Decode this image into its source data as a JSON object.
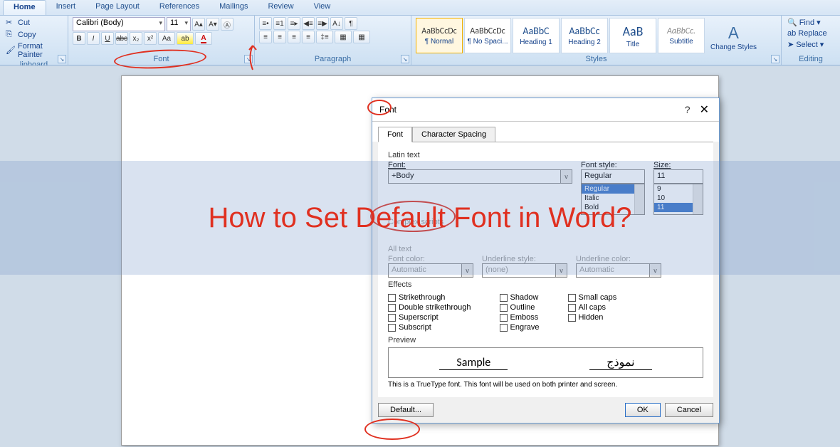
{
  "tabs": {
    "home": "Home",
    "insert": "Insert",
    "layout": "Page Layout",
    "refs": "References",
    "mail": "Mailings",
    "review": "Review",
    "view": "View"
  },
  "clipboard": {
    "cut": "Cut",
    "copy": "Copy",
    "painter": "Format Painter",
    "title": "lipboard"
  },
  "font": {
    "name": "Calibri (Body)",
    "size": "11",
    "title": "Font",
    "bold": "B",
    "italic": "I",
    "underline": "U",
    "strike": "abc",
    "sub": "x₂",
    "sup": "x²",
    "case": "Aa"
  },
  "paragraph": {
    "title": "Paragraph"
  },
  "styles": {
    "title": "Styles",
    "items": [
      {
        "prev": "AaBbCcDc",
        "label": "¶ Normal"
      },
      {
        "prev": "AaBbCcDc",
        "label": "¶ No Spaci..."
      },
      {
        "prev": "AaBbC",
        "label": "Heading 1"
      },
      {
        "prev": "AaBbCc",
        "label": "Heading 2"
      },
      {
        "prev": "AaB",
        "label": "Title"
      },
      {
        "prev": "AaBbCc.",
        "label": "Subtitle"
      }
    ],
    "change": "Change Styles"
  },
  "editing": {
    "find": "Find",
    "replace": "Replace",
    "select": "Select",
    "title": "Editing"
  },
  "dialog": {
    "title": "Font",
    "tab1": "Font",
    "tab2": "Character Spacing",
    "latin": "Latin text",
    "font_lbl": "Font:",
    "style_lbl": "Font style:",
    "size_lbl": "Size:",
    "font_val": "+Body",
    "style_val": "Regular",
    "size_val": "11",
    "style_opts": [
      "Regular",
      "Italic",
      "Bold"
    ],
    "size_opts": [
      "9",
      "10",
      "11"
    ],
    "complex": "Complex scripts",
    "alltext": "All text",
    "color_lbl": "Font color:",
    "ustyle_lbl": "Underline style:",
    "ucolor_lbl": "Underline color:",
    "color_val": "Automatic",
    "ustyle_val": "(none)",
    "ucolor_val": "Automatic",
    "effects_lbl": "Effects",
    "eff": {
      "strike": "Strikethrough",
      "dstrike": "Double strikethrough",
      "super": "Superscript",
      "sub": "Subscript",
      "shadow": "Shadow",
      "outline": "Outline",
      "emboss": "Emboss",
      "engrave": "Engrave",
      "scaps": "Small caps",
      "acaps": "All caps",
      "hidden": "Hidden"
    },
    "preview_lbl": "Preview",
    "sample1": "Sample",
    "sample2": "نموذج",
    "truetype": "This is a TrueType font. This font will be used on both printer and screen.",
    "default": "Default...",
    "ok": "OK",
    "cancel": "Cancel"
  },
  "overlay": "How to Set Default Font in Word?"
}
